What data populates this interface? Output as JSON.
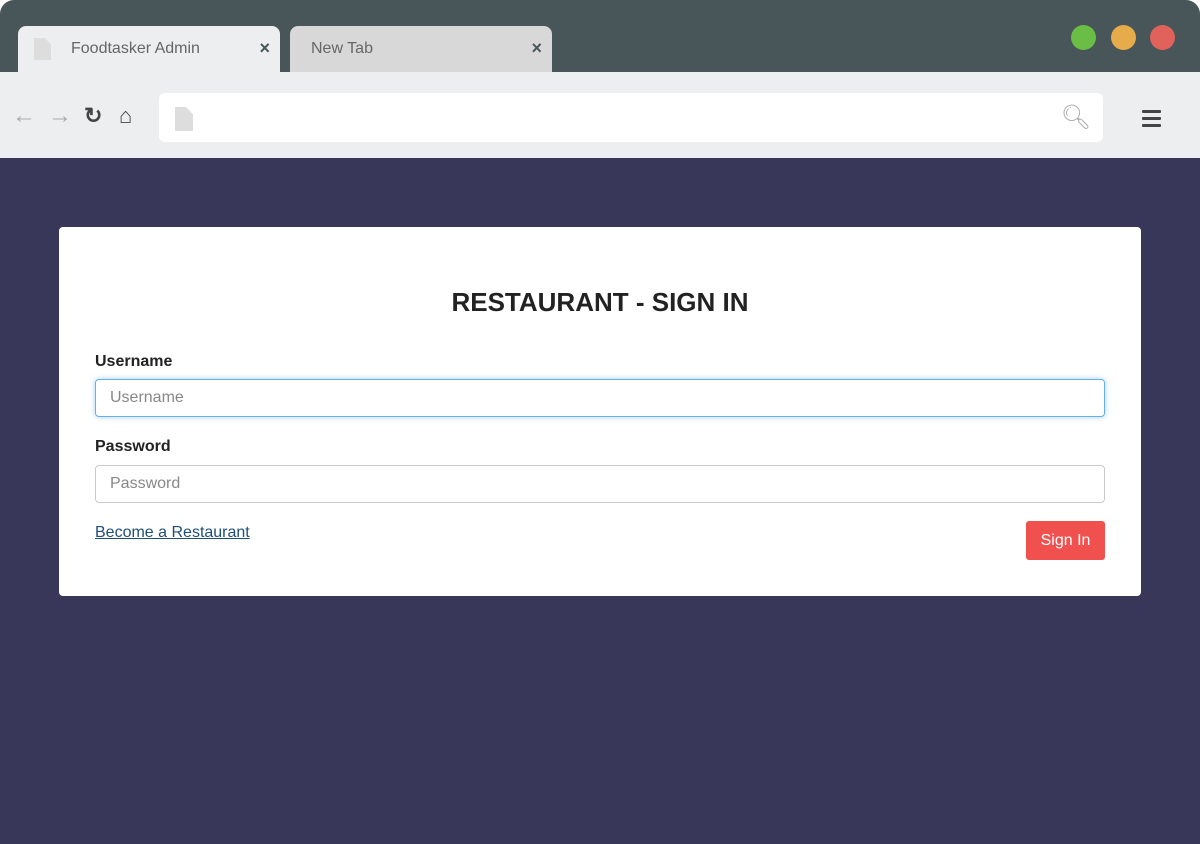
{
  "browser": {
    "tabs": [
      {
        "title": "Foodtasker Admin",
        "active": true
      },
      {
        "title": "New Tab",
        "active": false
      }
    ],
    "close_icon": "×",
    "address": "",
    "window_controls": {
      "green": "#6abd45",
      "yellow": "#e6ac4c",
      "red": "#e0625a"
    }
  },
  "page": {
    "background": "#383759",
    "title": "RESTAURANT - SIGN IN",
    "username": {
      "label": "Username",
      "placeholder": "Username",
      "value": ""
    },
    "password": {
      "label": "Password",
      "placeholder": "Password",
      "value": ""
    },
    "become_link": "Become a Restaurant",
    "sign_in_label": "Sign In",
    "accent": "#f0514f"
  }
}
